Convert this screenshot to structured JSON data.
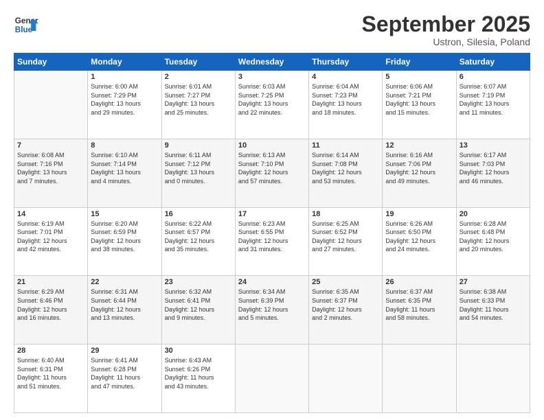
{
  "header": {
    "logo_line1": "General",
    "logo_line2": "Blue",
    "month": "September 2025",
    "location": "Ustron, Silesia, Poland"
  },
  "weekdays": [
    "Sunday",
    "Monday",
    "Tuesday",
    "Wednesday",
    "Thursday",
    "Friday",
    "Saturday"
  ],
  "weeks": [
    [
      {
        "day": "",
        "info": ""
      },
      {
        "day": "1",
        "info": "Sunrise: 6:00 AM\nSunset: 7:29 PM\nDaylight: 13 hours\nand 29 minutes."
      },
      {
        "day": "2",
        "info": "Sunrise: 6:01 AM\nSunset: 7:27 PM\nDaylight: 13 hours\nand 25 minutes."
      },
      {
        "day": "3",
        "info": "Sunrise: 6:03 AM\nSunset: 7:25 PM\nDaylight: 13 hours\nand 22 minutes."
      },
      {
        "day": "4",
        "info": "Sunrise: 6:04 AM\nSunset: 7:23 PM\nDaylight: 13 hours\nand 18 minutes."
      },
      {
        "day": "5",
        "info": "Sunrise: 6:06 AM\nSunset: 7:21 PM\nDaylight: 13 hours\nand 15 minutes."
      },
      {
        "day": "6",
        "info": "Sunrise: 6:07 AM\nSunset: 7:19 PM\nDaylight: 13 hours\nand 11 minutes."
      }
    ],
    [
      {
        "day": "7",
        "info": "Sunrise: 6:08 AM\nSunset: 7:16 PM\nDaylight: 13 hours\nand 7 minutes."
      },
      {
        "day": "8",
        "info": "Sunrise: 6:10 AM\nSunset: 7:14 PM\nDaylight: 13 hours\nand 4 minutes."
      },
      {
        "day": "9",
        "info": "Sunrise: 6:11 AM\nSunset: 7:12 PM\nDaylight: 13 hours\nand 0 minutes."
      },
      {
        "day": "10",
        "info": "Sunrise: 6:13 AM\nSunset: 7:10 PM\nDaylight: 12 hours\nand 57 minutes."
      },
      {
        "day": "11",
        "info": "Sunrise: 6:14 AM\nSunset: 7:08 PM\nDaylight: 12 hours\nand 53 minutes."
      },
      {
        "day": "12",
        "info": "Sunrise: 6:16 AM\nSunset: 7:06 PM\nDaylight: 12 hours\nand 49 minutes."
      },
      {
        "day": "13",
        "info": "Sunrise: 6:17 AM\nSunset: 7:03 PM\nDaylight: 12 hours\nand 46 minutes."
      }
    ],
    [
      {
        "day": "14",
        "info": "Sunrise: 6:19 AM\nSunset: 7:01 PM\nDaylight: 12 hours\nand 42 minutes."
      },
      {
        "day": "15",
        "info": "Sunrise: 6:20 AM\nSunset: 6:59 PM\nDaylight: 12 hours\nand 38 minutes."
      },
      {
        "day": "16",
        "info": "Sunrise: 6:22 AM\nSunset: 6:57 PM\nDaylight: 12 hours\nand 35 minutes."
      },
      {
        "day": "17",
        "info": "Sunrise: 6:23 AM\nSunset: 6:55 PM\nDaylight: 12 hours\nand 31 minutes."
      },
      {
        "day": "18",
        "info": "Sunrise: 6:25 AM\nSunset: 6:52 PM\nDaylight: 12 hours\nand 27 minutes."
      },
      {
        "day": "19",
        "info": "Sunrise: 6:26 AM\nSunset: 6:50 PM\nDaylight: 12 hours\nand 24 minutes."
      },
      {
        "day": "20",
        "info": "Sunrise: 6:28 AM\nSunset: 6:48 PM\nDaylight: 12 hours\nand 20 minutes."
      }
    ],
    [
      {
        "day": "21",
        "info": "Sunrise: 6:29 AM\nSunset: 6:46 PM\nDaylight: 12 hours\nand 16 minutes."
      },
      {
        "day": "22",
        "info": "Sunrise: 6:31 AM\nSunset: 6:44 PM\nDaylight: 12 hours\nand 13 minutes."
      },
      {
        "day": "23",
        "info": "Sunrise: 6:32 AM\nSunset: 6:41 PM\nDaylight: 12 hours\nand 9 minutes."
      },
      {
        "day": "24",
        "info": "Sunrise: 6:34 AM\nSunset: 6:39 PM\nDaylight: 12 hours\nand 5 minutes."
      },
      {
        "day": "25",
        "info": "Sunrise: 6:35 AM\nSunset: 6:37 PM\nDaylight: 12 hours\nand 2 minutes."
      },
      {
        "day": "26",
        "info": "Sunrise: 6:37 AM\nSunset: 6:35 PM\nDaylight: 11 hours\nand 58 minutes."
      },
      {
        "day": "27",
        "info": "Sunrise: 6:38 AM\nSunset: 6:33 PM\nDaylight: 11 hours\nand 54 minutes."
      }
    ],
    [
      {
        "day": "28",
        "info": "Sunrise: 6:40 AM\nSunset: 6:31 PM\nDaylight: 11 hours\nand 51 minutes."
      },
      {
        "day": "29",
        "info": "Sunrise: 6:41 AM\nSunset: 6:28 PM\nDaylight: 11 hours\nand 47 minutes."
      },
      {
        "day": "30",
        "info": "Sunrise: 6:43 AM\nSunset: 6:26 PM\nDaylight: 11 hours\nand 43 minutes."
      },
      {
        "day": "",
        "info": ""
      },
      {
        "day": "",
        "info": ""
      },
      {
        "day": "",
        "info": ""
      },
      {
        "day": "",
        "info": ""
      }
    ]
  ]
}
